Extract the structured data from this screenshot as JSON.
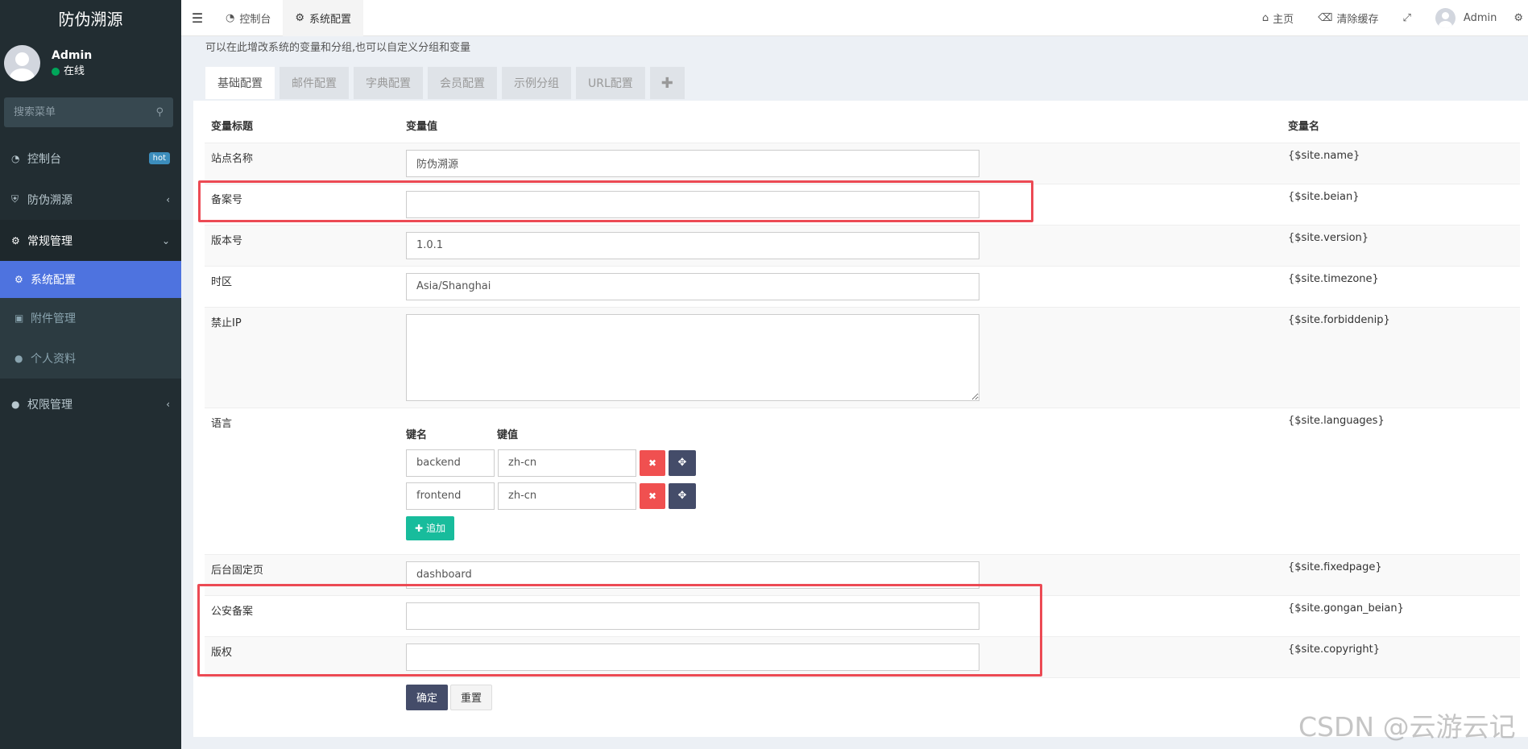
{
  "sidebar": {
    "logo": "防伪溯源",
    "user": {
      "name": "Admin",
      "status": "在线"
    },
    "search_placeholder": "搜索菜单",
    "menu": [
      {
        "label": "控制台",
        "icon": "dashboard-icon",
        "badge": "hot"
      },
      {
        "label": "防伪溯源",
        "icon": "shield-icon"
      },
      {
        "label": "常规管理",
        "icon": "cogs-icon"
      },
      {
        "label": "系统配置",
        "icon": "gear-icon"
      },
      {
        "label": "附件管理",
        "icon": "file-image-icon"
      },
      {
        "label": "个人资料",
        "icon": "user-icon"
      },
      {
        "label": "权限管理",
        "icon": "users-icon"
      }
    ]
  },
  "topbar": {
    "tabs": [
      {
        "label": "控制台",
        "icon": "dashboard-icon"
      },
      {
        "label": "系统配置",
        "icon": "gear-icon"
      }
    ],
    "home": "主页",
    "clear_cache": "清除缓存",
    "admin": "Admin"
  },
  "content": {
    "description": "可以在此增改系统的变量和分组,也可以自定义分组和变量",
    "tabs": [
      "基础配置",
      "邮件配置",
      "字典配置",
      "会员配置",
      "示例分组",
      "URL配置"
    ],
    "headers": {
      "title": "变量标题",
      "value": "变量值",
      "name": "变量名"
    },
    "rows": [
      {
        "title": "站点名称",
        "value": "防伪溯源",
        "var": "{$site.name}"
      },
      {
        "title": "备案号",
        "value": "",
        "var": "{$site.beian}"
      },
      {
        "title": "版本号",
        "value": "1.0.1",
        "var": "{$site.version}"
      },
      {
        "title": "时区",
        "value": "Asia/Shanghai",
        "var": "{$site.timezone}"
      },
      {
        "title": "禁止IP",
        "value": "",
        "var": "{$site.forbiddenip}"
      },
      {
        "title": "语言",
        "var": "{$site.languages}"
      },
      {
        "title": "后台固定页",
        "value": "dashboard",
        "var": "{$site.fixedpage}"
      },
      {
        "title": "公安备案",
        "value": "",
        "var": "{$site.gongan_beian}"
      },
      {
        "title": "版权",
        "value": "",
        "var": "{$site.copyright}"
      }
    ],
    "language": {
      "key_header": "键名",
      "value_header": "键值",
      "entries": [
        {
          "key": "backend",
          "value": "zh-cn"
        },
        {
          "key": "frontend",
          "value": "zh-cn"
        }
      ],
      "add_label": "追加"
    },
    "submit_label": "确定",
    "reset_label": "重置"
  },
  "watermark": "CSDN @云游云记",
  "colors": {
    "sidebar_bg": "#222d32",
    "active_menu": "#4e73df",
    "highlight": "#ec4a54",
    "add_button": "#18bc9c",
    "delete_button": "#f05050"
  }
}
